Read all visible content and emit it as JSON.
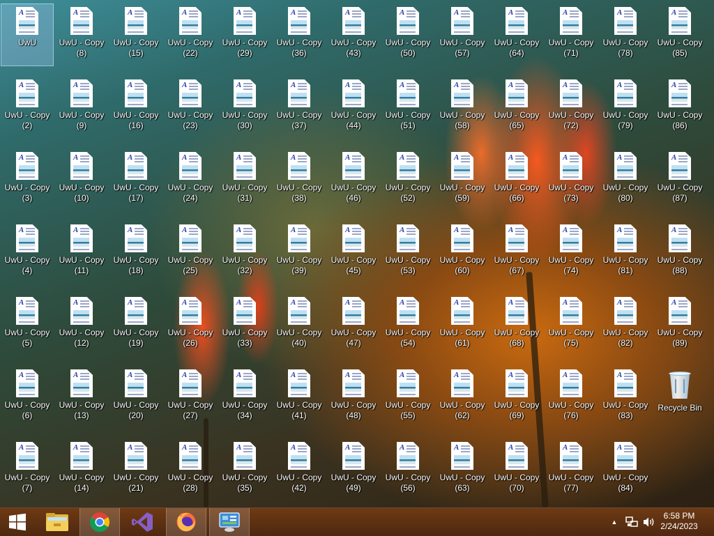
{
  "desktop": {
    "icons": [
      {
        "line1": "UwU",
        "line2": "",
        "type": "doc",
        "selected": true
      },
      {
        "line1": "UwU - Copy",
        "line2": "(2)",
        "type": "doc"
      },
      {
        "line1": "UwU - Copy",
        "line2": "(3)",
        "type": "doc"
      },
      {
        "line1": "UwU - Copy",
        "line2": "(4)",
        "type": "doc"
      },
      {
        "line1": "UwU - Copy",
        "line2": "(5)",
        "type": "doc"
      },
      {
        "line1": "UwU - Copy",
        "line2": "(6)",
        "type": "doc"
      },
      {
        "line1": "UwU - Copy",
        "line2": "(7)",
        "type": "doc"
      },
      {
        "line1": "UwU - Copy",
        "line2": "(8)",
        "type": "doc"
      },
      {
        "line1": "UwU - Copy",
        "line2": "(9)",
        "type": "doc"
      },
      {
        "line1": "UwU - Copy",
        "line2": "(10)",
        "type": "doc"
      },
      {
        "line1": "UwU - Copy",
        "line2": "(11)",
        "type": "doc"
      },
      {
        "line1": "UwU - Copy",
        "line2": "(12)",
        "type": "doc"
      },
      {
        "line1": "UwU - Copy",
        "line2": "(13)",
        "type": "doc"
      },
      {
        "line1": "UwU - Copy",
        "line2": "(14)",
        "type": "doc"
      },
      {
        "line1": "UwU - Copy",
        "line2": "(15)",
        "type": "doc"
      },
      {
        "line1": "UwU - Copy",
        "line2": "(16)",
        "type": "doc"
      },
      {
        "line1": "UwU - Copy",
        "line2": "(17)",
        "type": "doc"
      },
      {
        "line1": "UwU - Copy",
        "line2": "(18)",
        "type": "doc"
      },
      {
        "line1": "UwU - Copy",
        "line2": "(19)",
        "type": "doc"
      },
      {
        "line1": "UwU - Copy",
        "line2": "(20)",
        "type": "doc"
      },
      {
        "line1": "UwU - Copy",
        "line2": "(21)",
        "type": "doc"
      },
      {
        "line1": "UwU - Copy",
        "line2": "(22)",
        "type": "doc"
      },
      {
        "line1": "UwU - Copy",
        "line2": "(23)",
        "type": "doc"
      },
      {
        "line1": "UwU - Copy",
        "line2": "(24)",
        "type": "doc"
      },
      {
        "line1": "UwU - Copy",
        "line2": "(25)",
        "type": "doc"
      },
      {
        "line1": "UwU - Copy",
        "line2": "(26)",
        "type": "doc"
      },
      {
        "line1": "UwU - Copy",
        "line2": "(27)",
        "type": "doc"
      },
      {
        "line1": "UwU - Copy",
        "line2": "(28)",
        "type": "doc"
      },
      {
        "line1": "UwU - Copy",
        "line2": "(29)",
        "type": "doc"
      },
      {
        "line1": "UwU - Copy",
        "line2": "(30)",
        "type": "doc"
      },
      {
        "line1": "UwU - Copy",
        "line2": "(31)",
        "type": "doc"
      },
      {
        "line1": "UwU - Copy",
        "line2": "(32)",
        "type": "doc"
      },
      {
        "line1": "UwU - Copy",
        "line2": "(33)",
        "type": "doc"
      },
      {
        "line1": "UwU - Copy",
        "line2": "(34)",
        "type": "doc"
      },
      {
        "line1": "UwU - Copy",
        "line2": "(35)",
        "type": "doc"
      },
      {
        "line1": "UwU - Copy",
        "line2": "(36)",
        "type": "doc"
      },
      {
        "line1": "UwU - Copy",
        "line2": "(37)",
        "type": "doc"
      },
      {
        "line1": "UwU - Copy",
        "line2": "(38)",
        "type": "doc"
      },
      {
        "line1": "UwU - Copy",
        "line2": "(39)",
        "type": "doc"
      },
      {
        "line1": "UwU - Copy",
        "line2": "(40)",
        "type": "doc"
      },
      {
        "line1": "UwU - Copy",
        "line2": "(41)",
        "type": "doc"
      },
      {
        "line1": "UwU - Copy",
        "line2": "(42)",
        "type": "doc"
      },
      {
        "line1": "UwU - Copy",
        "line2": "(43)",
        "type": "doc"
      },
      {
        "line1": "UwU - Copy",
        "line2": "(44)",
        "type": "doc"
      },
      {
        "line1": "UwU - Copy",
        "line2": "(46)",
        "type": "doc"
      },
      {
        "line1": "UwU - Copy",
        "line2": "(45)",
        "type": "doc"
      },
      {
        "line1": "UwU - Copy",
        "line2": "(47)",
        "type": "doc"
      },
      {
        "line1": "UwU - Copy",
        "line2": "(48)",
        "type": "doc"
      },
      {
        "line1": "UwU - Copy",
        "line2": "(49)",
        "type": "doc"
      },
      {
        "line1": "UwU - Copy",
        "line2": "(50)",
        "type": "doc"
      },
      {
        "line1": "UwU - Copy",
        "line2": "(51)",
        "type": "doc"
      },
      {
        "line1": "UwU - Copy",
        "line2": "(52)",
        "type": "doc"
      },
      {
        "line1": "UwU - Copy",
        "line2": "(53)",
        "type": "doc"
      },
      {
        "line1": "UwU - Copy",
        "line2": "(54)",
        "type": "doc"
      },
      {
        "line1": "UwU - Copy",
        "line2": "(55)",
        "type": "doc"
      },
      {
        "line1": "UwU - Copy",
        "line2": "(56)",
        "type": "doc"
      },
      {
        "line1": "UwU - Copy",
        "line2": "(57)",
        "type": "doc"
      },
      {
        "line1": "UwU - Copy",
        "line2": "(58)",
        "type": "doc"
      },
      {
        "line1": "UwU - Copy",
        "line2": "(59)",
        "type": "doc"
      },
      {
        "line1": "UwU - Copy",
        "line2": "(60)",
        "type": "doc"
      },
      {
        "line1": "UwU - Copy",
        "line2": "(61)",
        "type": "doc"
      },
      {
        "line1": "UwU - Copy",
        "line2": "(62)",
        "type": "doc"
      },
      {
        "line1": "UwU - Copy",
        "line2": "(63)",
        "type": "doc"
      },
      {
        "line1": "UwU - Copy",
        "line2": "(64)",
        "type": "doc"
      },
      {
        "line1": "UwU - Copy",
        "line2": "(65)",
        "type": "doc"
      },
      {
        "line1": "UwU - Copy",
        "line2": "(66)",
        "type": "doc"
      },
      {
        "line1": "UwU - Copy",
        "line2": "(67)",
        "type": "doc"
      },
      {
        "line1": "UwU - Copy",
        "line2": "(68)",
        "type": "doc"
      },
      {
        "line1": "UwU - Copy",
        "line2": "(69)",
        "type": "doc"
      },
      {
        "line1": "UwU - Copy",
        "line2": "(70)",
        "type": "doc"
      },
      {
        "line1": "UwU - Copy",
        "line2": "(71)",
        "type": "doc"
      },
      {
        "line1": "UwU - Copy",
        "line2": "(72)",
        "type": "doc"
      },
      {
        "line1": "UwU - Copy",
        "line2": "(73)",
        "type": "doc"
      },
      {
        "line1": "UwU - Copy",
        "line2": "(74)",
        "type": "doc"
      },
      {
        "line1": "UwU - Copy",
        "line2": "(75)",
        "type": "doc"
      },
      {
        "line1": "UwU - Copy",
        "line2": "(76)",
        "type": "doc"
      },
      {
        "line1": "UwU - Copy",
        "line2": "(77)",
        "type": "doc"
      },
      {
        "line1": "UwU - Copy",
        "line2": "(78)",
        "type": "doc"
      },
      {
        "line1": "UwU - Copy",
        "line2": "(79)",
        "type": "doc"
      },
      {
        "line1": "UwU - Copy",
        "line2": "(80)",
        "type": "doc"
      },
      {
        "line1": "UwU - Copy",
        "line2": "(81)",
        "type": "doc"
      },
      {
        "line1": "UwU - Copy",
        "line2": "(82)",
        "type": "doc"
      },
      {
        "line1": "UwU - Copy",
        "line2": "(83)",
        "type": "doc"
      },
      {
        "line1": "UwU - Copy",
        "line2": "(84)",
        "type": "doc"
      },
      {
        "line1": "UwU - Copy",
        "line2": "(85)",
        "type": "doc"
      },
      {
        "line1": "UwU - Copy",
        "line2": "(86)",
        "type": "doc"
      },
      {
        "line1": "UwU - Copy",
        "line2": "(87)",
        "type": "doc"
      },
      {
        "line1": "UwU - Copy",
        "line2": "(88)",
        "type": "doc"
      },
      {
        "line1": "UwU - Copy",
        "line2": "(89)",
        "type": "doc"
      },
      {
        "line1": "Recycle Bin",
        "line2": "",
        "type": "recycle-bin"
      }
    ]
  },
  "taskbar": {
    "buttons": [
      {
        "name": "start-button",
        "icon": "windows-logo-icon"
      },
      {
        "name": "taskbar-file-explorer",
        "icon": "file-explorer-icon"
      },
      {
        "name": "taskbar-chrome",
        "icon": "chrome-icon",
        "active": true
      },
      {
        "name": "taskbar-visual-studio",
        "icon": "visual-studio-icon"
      },
      {
        "name": "taskbar-firefox",
        "icon": "firefox-icon",
        "active": true
      },
      {
        "name": "taskbar-control-panel",
        "icon": "control-panel-icon",
        "active": true
      }
    ],
    "tray": {
      "icons": [
        "chevron-up-icon",
        "network-icon",
        "volume-icon"
      ],
      "time": "6:58 PM",
      "date": "2/24/2023"
    }
  },
  "colors": {
    "taskbar": "#5a2e12",
    "doc_letter": "#2a3fa8",
    "chrome_red": "#db4437",
    "chrome_yellow": "#f4c20d",
    "chrome_green": "#0f9d58",
    "chrome_blue": "#4285f4",
    "vs_purple": "#865fc5"
  }
}
